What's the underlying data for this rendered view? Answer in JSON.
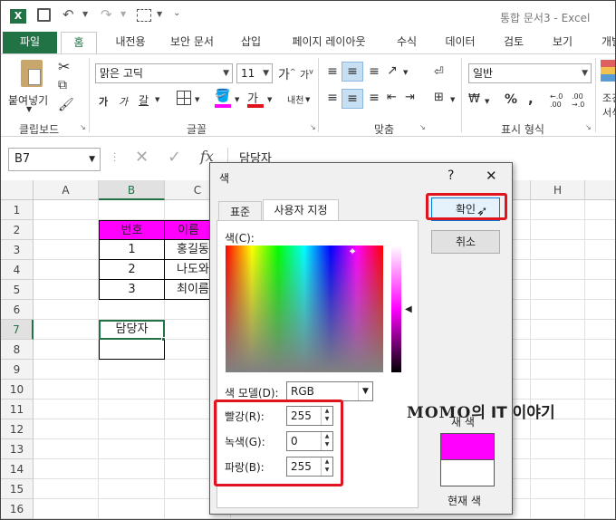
{
  "window": {
    "title": "통합 문서3 - Excel"
  },
  "tabs": [
    "파일",
    "홈",
    "내전용",
    "보안 문서",
    "삽입",
    "페이지 레이아웃",
    "수식",
    "데이터",
    "검토",
    "보기",
    "개발"
  ],
  "ribbon": {
    "paste_label": "붙여넣기",
    "font_name": "맑은 고딕",
    "font_size": "11",
    "number_format": "일반",
    "wrap_label": "내천",
    "group_labels": {
      "clipboard": "클립보드",
      "font": "글꼴",
      "alignment": "맞춤",
      "number": "표시 형식"
    },
    "extra_label_1": "조건",
    "extra_label_2": "서식"
  },
  "formula_bar": {
    "name_box": "B7",
    "fx": "fx",
    "content": "담당자"
  },
  "sheet": {
    "columns": [
      "A",
      "B",
      "C",
      "H"
    ],
    "rows": [
      "1",
      "2",
      "3",
      "4",
      "5",
      "6",
      "7",
      "8",
      "9",
      "10",
      "11",
      "12",
      "13",
      "14",
      "15",
      "16"
    ],
    "header_row": {
      "num": "번호",
      "name": "이름"
    },
    "data": [
      {
        "num": "1",
        "name": "홍길동"
      },
      {
        "num": "2",
        "name": "나도와"
      },
      {
        "num": "3",
        "name": "최이름"
      }
    ],
    "b7": "담당자",
    "header_color": "#ff00ff"
  },
  "dialog": {
    "title": "색",
    "help": "?",
    "close": "✕",
    "tab_standard": "표준",
    "tab_custom": "사용자 지정",
    "colors_label": "색(C):",
    "model_label": "색 모델(D):",
    "model_value": "RGB",
    "red_label": "빨강(R):",
    "green_label": "녹색(G):",
    "blue_label": "파랑(B):",
    "red": "255",
    "green": "0",
    "blue": "255",
    "ok": "확인",
    "cancel": "취소",
    "new_label": "새 색",
    "current_label": "현재 색",
    "new_color": "#ff00ff",
    "current_color": "#ffffff"
  },
  "watermark": {
    "brand": "MOMO",
    "rest": "의 IT 이야기"
  }
}
